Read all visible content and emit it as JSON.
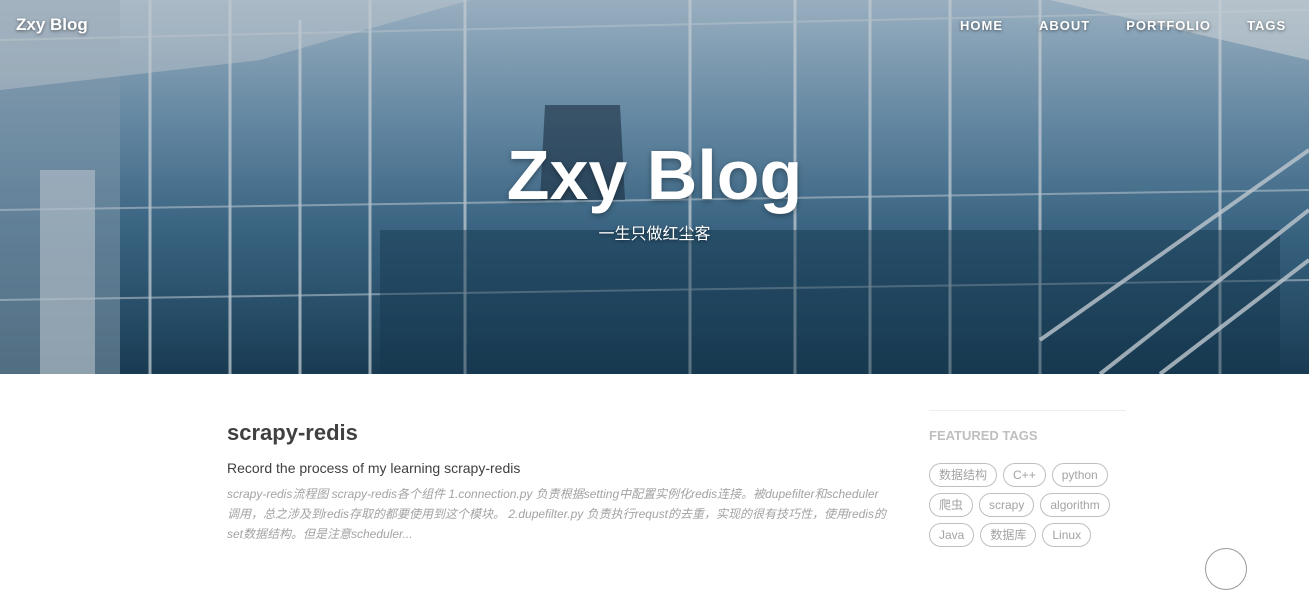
{
  "brand": "Zxy Blog",
  "nav": {
    "items": [
      "HOME",
      "ABOUT",
      "PORTFOLIO",
      "TAGS"
    ]
  },
  "hero": {
    "title": "Zxy Blog",
    "subtitle": "一生只做红尘客"
  },
  "post": {
    "title": "scrapy-redis",
    "subtitle": "Record the process of my learning scrapy-redis",
    "excerpt": "scrapy-redis流程图 scrapy-redis各个组件 1.connection.py 负责根据setting中配置实例化redis连接。被dupefilter和scheduler调用，总之涉及到redis存取的都要使用到这个模块。 2.dupefilter.py 负责执行requst的去重，实现的很有技巧性，使用redis的set数据结构。但是注意scheduler..."
  },
  "sidebar": {
    "heading": "FEATURED TAGS",
    "tags": [
      "数据结构",
      "C++",
      "python",
      "爬虫",
      "scrapy",
      "algorithm",
      "Java",
      "数据库",
      "Linux"
    ]
  },
  "colors": {
    "text": "#404040",
    "muted": "#a3a3a3",
    "tag_border": "#bfbfbf"
  }
}
